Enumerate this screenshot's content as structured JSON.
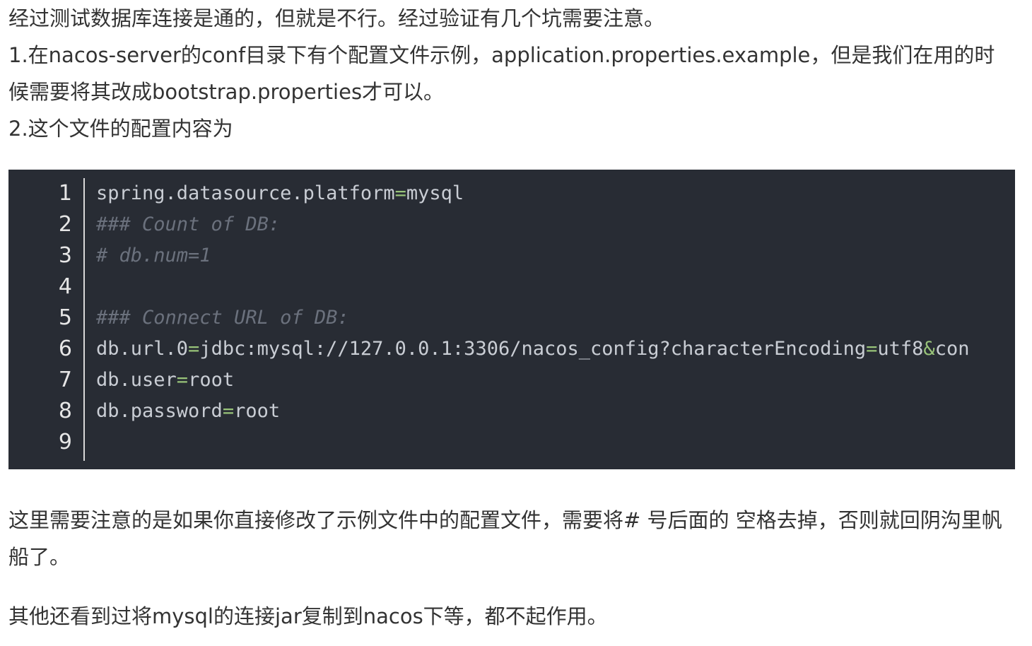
{
  "intro": [
    "经过测试数据库连接是通的，但就是不行。经过验证有几个坑需要注意。",
    "1.在nacos-server的conf目录下有个配置文件示例，application.properties.example，但是我们在用的时候需要将其改成bootstrap.properties才可以。",
    "2.这个文件的配置内容为"
  ],
  "code": {
    "line_numbers": [
      "1",
      "2",
      "3",
      "4",
      "5",
      "6",
      "7",
      "8",
      "9"
    ],
    "lines": [
      {
        "type": "kv",
        "key": "spring.datasource.platform",
        "op": "=",
        "value": "mysql"
      },
      {
        "type": "comment",
        "text": "### Count of DB:"
      },
      {
        "type": "comment",
        "text": "# db.num=1"
      },
      {
        "type": "empty",
        "text": ""
      },
      {
        "type": "comment",
        "text": "### Connect URL of DB:"
      },
      {
        "type": "url",
        "key": "db.url.0",
        "op": "=",
        "value1": "jdbc:mysql://127.0.0.1:3306/nacos_config?characterEncoding",
        "op2": "=",
        "value2": "utf8",
        "op3": "&",
        "value3": "con"
      },
      {
        "type": "kv",
        "key": "db.user",
        "op": "=",
        "value": "root"
      },
      {
        "type": "kv",
        "key": "db.password",
        "op": "=",
        "value": "root"
      },
      {
        "type": "empty",
        "text": ""
      }
    ]
  },
  "notes": [
    "这里需要注意的是如果你直接修改了示例文件中的配置文件，需要将# 号后面的 空格去掉，否则就回阴沟里帆船了。",
    "其他还看到过将mysql的连接jar复制到nacos下等，都不起作用。"
  ]
}
